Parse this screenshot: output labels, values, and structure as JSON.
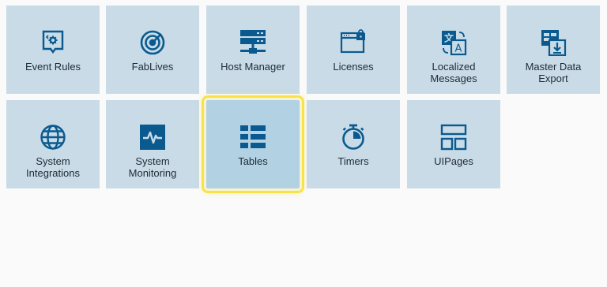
{
  "tiles": [
    {
      "label": "Event Rules",
      "icon": "event-rules-icon"
    },
    {
      "label": "FabLives",
      "icon": "radar-icon"
    },
    {
      "label": "Host Manager",
      "icon": "server-icon"
    },
    {
      "label": "Licenses",
      "icon": "locked-window-icon"
    },
    {
      "label": "Localized Messages",
      "icon": "translate-icon"
    },
    {
      "label": "Master Data Export",
      "icon": "data-export-icon"
    },
    {
      "label": "System Integrations",
      "icon": "globe-icon"
    },
    {
      "label": "System Monitoring",
      "icon": "pulse-monitor-icon"
    },
    {
      "label": "Tables",
      "icon": "table-icon"
    },
    {
      "label": "Timers",
      "icon": "stopwatch-icon"
    },
    {
      "label": "UIPages",
      "icon": "page-layout-icon"
    }
  ],
  "selected_tile": "Tables",
  "colors": {
    "tile_bg": "#c8dbe7",
    "tile_selected_bg": "#b2d1e3",
    "icon": "#0b5a8f",
    "highlight": "#f7e24a"
  }
}
